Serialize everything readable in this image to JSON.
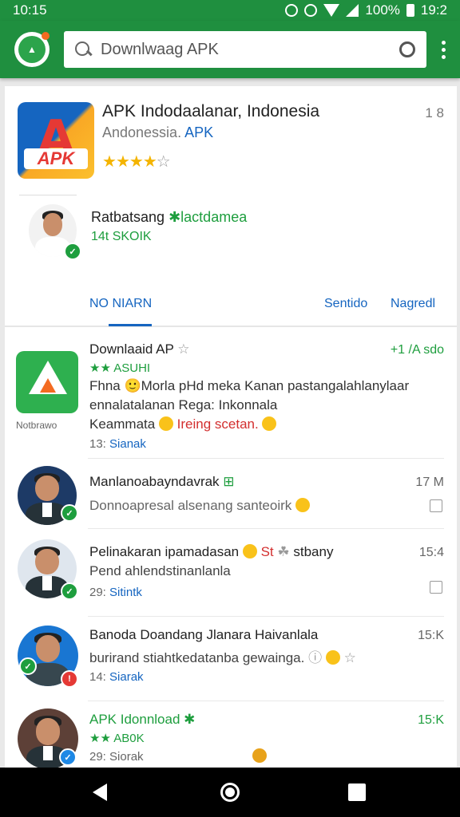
{
  "status_bar": {
    "time": "10:15",
    "battery_pct": "100%",
    "right_text": "19:2"
  },
  "toolbar": {
    "search_text": "Downlwaag APK"
  },
  "top_app": {
    "icon_text": "APK",
    "title": "APK Indodaalanar, Indonesia",
    "side_meta": "1 8",
    "subtitle_gray": "Andonessia.",
    "subtitle_blue": "APK",
    "rating": 4,
    "max_rating": 5
  },
  "developer": {
    "name": "Ratbatsang",
    "name_green": "✱lactdamea",
    "stat": "14t SKOIK"
  },
  "tabs": [
    {
      "label": "NO NIARN"
    },
    {
      "label": "Sentido"
    },
    {
      "label": "Nagredl"
    }
  ],
  "feed": [
    {
      "title": "Downlaaid AP",
      "rating_text": "★★ ASUHI",
      "right": "+1 /A sdo",
      "line1": "Fhna 🙂Morla pHd meka Kanan pastangalahlanylaar",
      "line2": "ennalatalanan Rega: Inkonnala",
      "line3_a": "Keammata",
      "line3_red": "Ireing scetan.",
      "meta_count": "13:",
      "meta_blue": "Sianak",
      "tile_caption": "Notbrawo"
    },
    {
      "title": "Manlanoabayndavrak",
      "right": "17 M",
      "line1": "Donnoapresal alsenang santeoirk",
      "meta_count": "",
      "meta_blue": ""
    },
    {
      "title": "Pelinakaran ipamadasan",
      "title_red": "St",
      "title_tail": "stbany",
      "right": "15:4",
      "line1": "Pend ahlendstinanlanla",
      "meta_count": "29:",
      "meta_blue": "Sitintk"
    },
    {
      "title": "Banoda Doandang Jlanara Haivanlala",
      "right": "15:K",
      "line1": "burirand stiahtkedatanba gewainga.",
      "meta_count": "14:",
      "meta_blue": "Siarak"
    },
    {
      "title": "APK Idonnload ✱",
      "rating_text": "★★ AB0K",
      "right": "15:K",
      "meta_count": "29:",
      "meta_blue": "Siorak"
    }
  ]
}
